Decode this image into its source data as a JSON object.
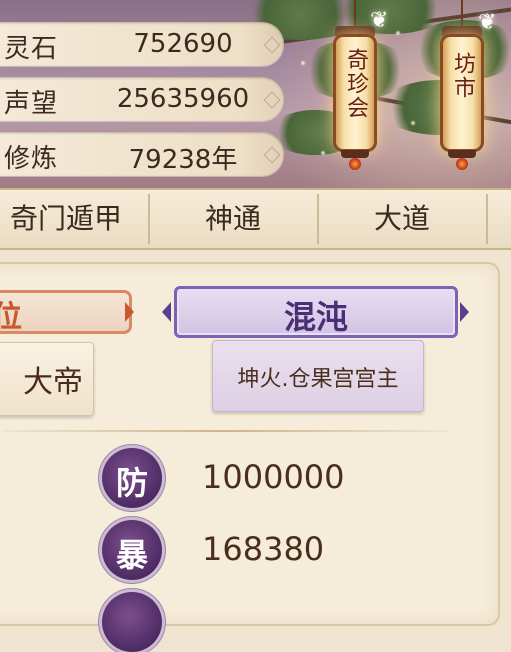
{
  "stats": [
    {
      "label": "灵石",
      "value": "752690"
    },
    {
      "label": "声望",
      "value": "25635960"
    },
    {
      "label": "修炼",
      "value": "79238年"
    }
  ],
  "lanterns": [
    {
      "label": "奇珍会"
    },
    {
      "label": "坊市"
    }
  ],
  "tabs": [
    "奇门遁甲",
    "神通",
    "大道"
  ],
  "ranks": [
    {
      "badge": "位",
      "title": "大帝"
    },
    {
      "badge": "混沌",
      "title": "坤火.仓果宫宫主"
    }
  ],
  "attributes": [
    {
      "icon": "防",
      "value": "1000000"
    },
    {
      "icon": "暴",
      "value": "168380"
    }
  ],
  "colors": {
    "accent_purple": "#5a3e8e",
    "accent_orange": "#c8643a",
    "text_dark": "#3a2a20"
  }
}
